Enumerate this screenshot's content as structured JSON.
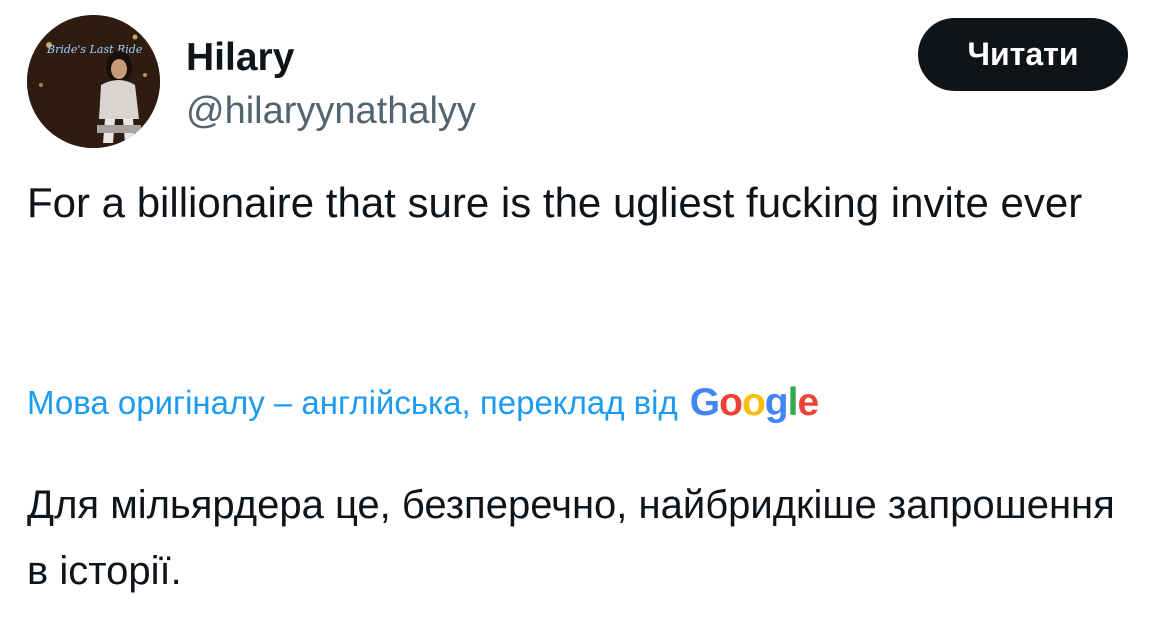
{
  "author": {
    "name": "Hilary",
    "handle": "@hilaryynathalyy",
    "avatar_caption": "Bride's Last Ride"
  },
  "follow_button": {
    "label": "Читати"
  },
  "tweet": {
    "text": "For a billionaire that sure is the ugliest fucking invite ever"
  },
  "translation": {
    "note": "Мова оригіналу – англійська, переклад від",
    "provider_letters": [
      "G",
      "o",
      "o",
      "g",
      "l",
      "e"
    ],
    "text": "Для мільярдера це, безперечно, найбридкіше запрошення в історії."
  },
  "colors": {
    "text": "#0f1419",
    "secondary_text": "#536471",
    "link": "#1d9bf0",
    "button_bg": "#0f1419",
    "button_text": "#ffffff",
    "google_blue": "#4285f4",
    "google_red": "#ea4335",
    "google_yellow": "#fbbc05",
    "google_green": "#34a853"
  }
}
